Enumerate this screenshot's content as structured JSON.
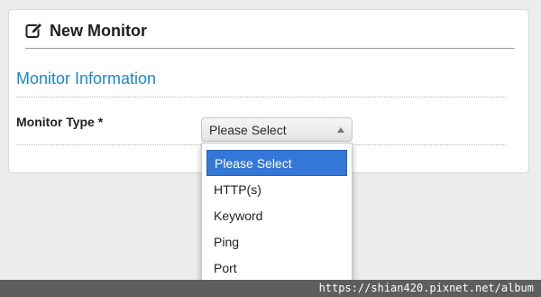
{
  "panel": {
    "title": "New Monitor",
    "title_icon": "edit-icon"
  },
  "section": {
    "heading": "Monitor Information"
  },
  "form": {
    "monitor_type_label": "Monitor Type *",
    "monitor_type_value": "Please Select",
    "options": [
      "Please Select",
      "HTTP(s)",
      "Keyword",
      "Ping",
      "Port"
    ],
    "selected_option": "Please Select"
  },
  "colors": {
    "heading_accent": "#1b86d9",
    "selected_option_bg": "#3477d6"
  },
  "watermark": "https://shian420.pixnet.net/album"
}
